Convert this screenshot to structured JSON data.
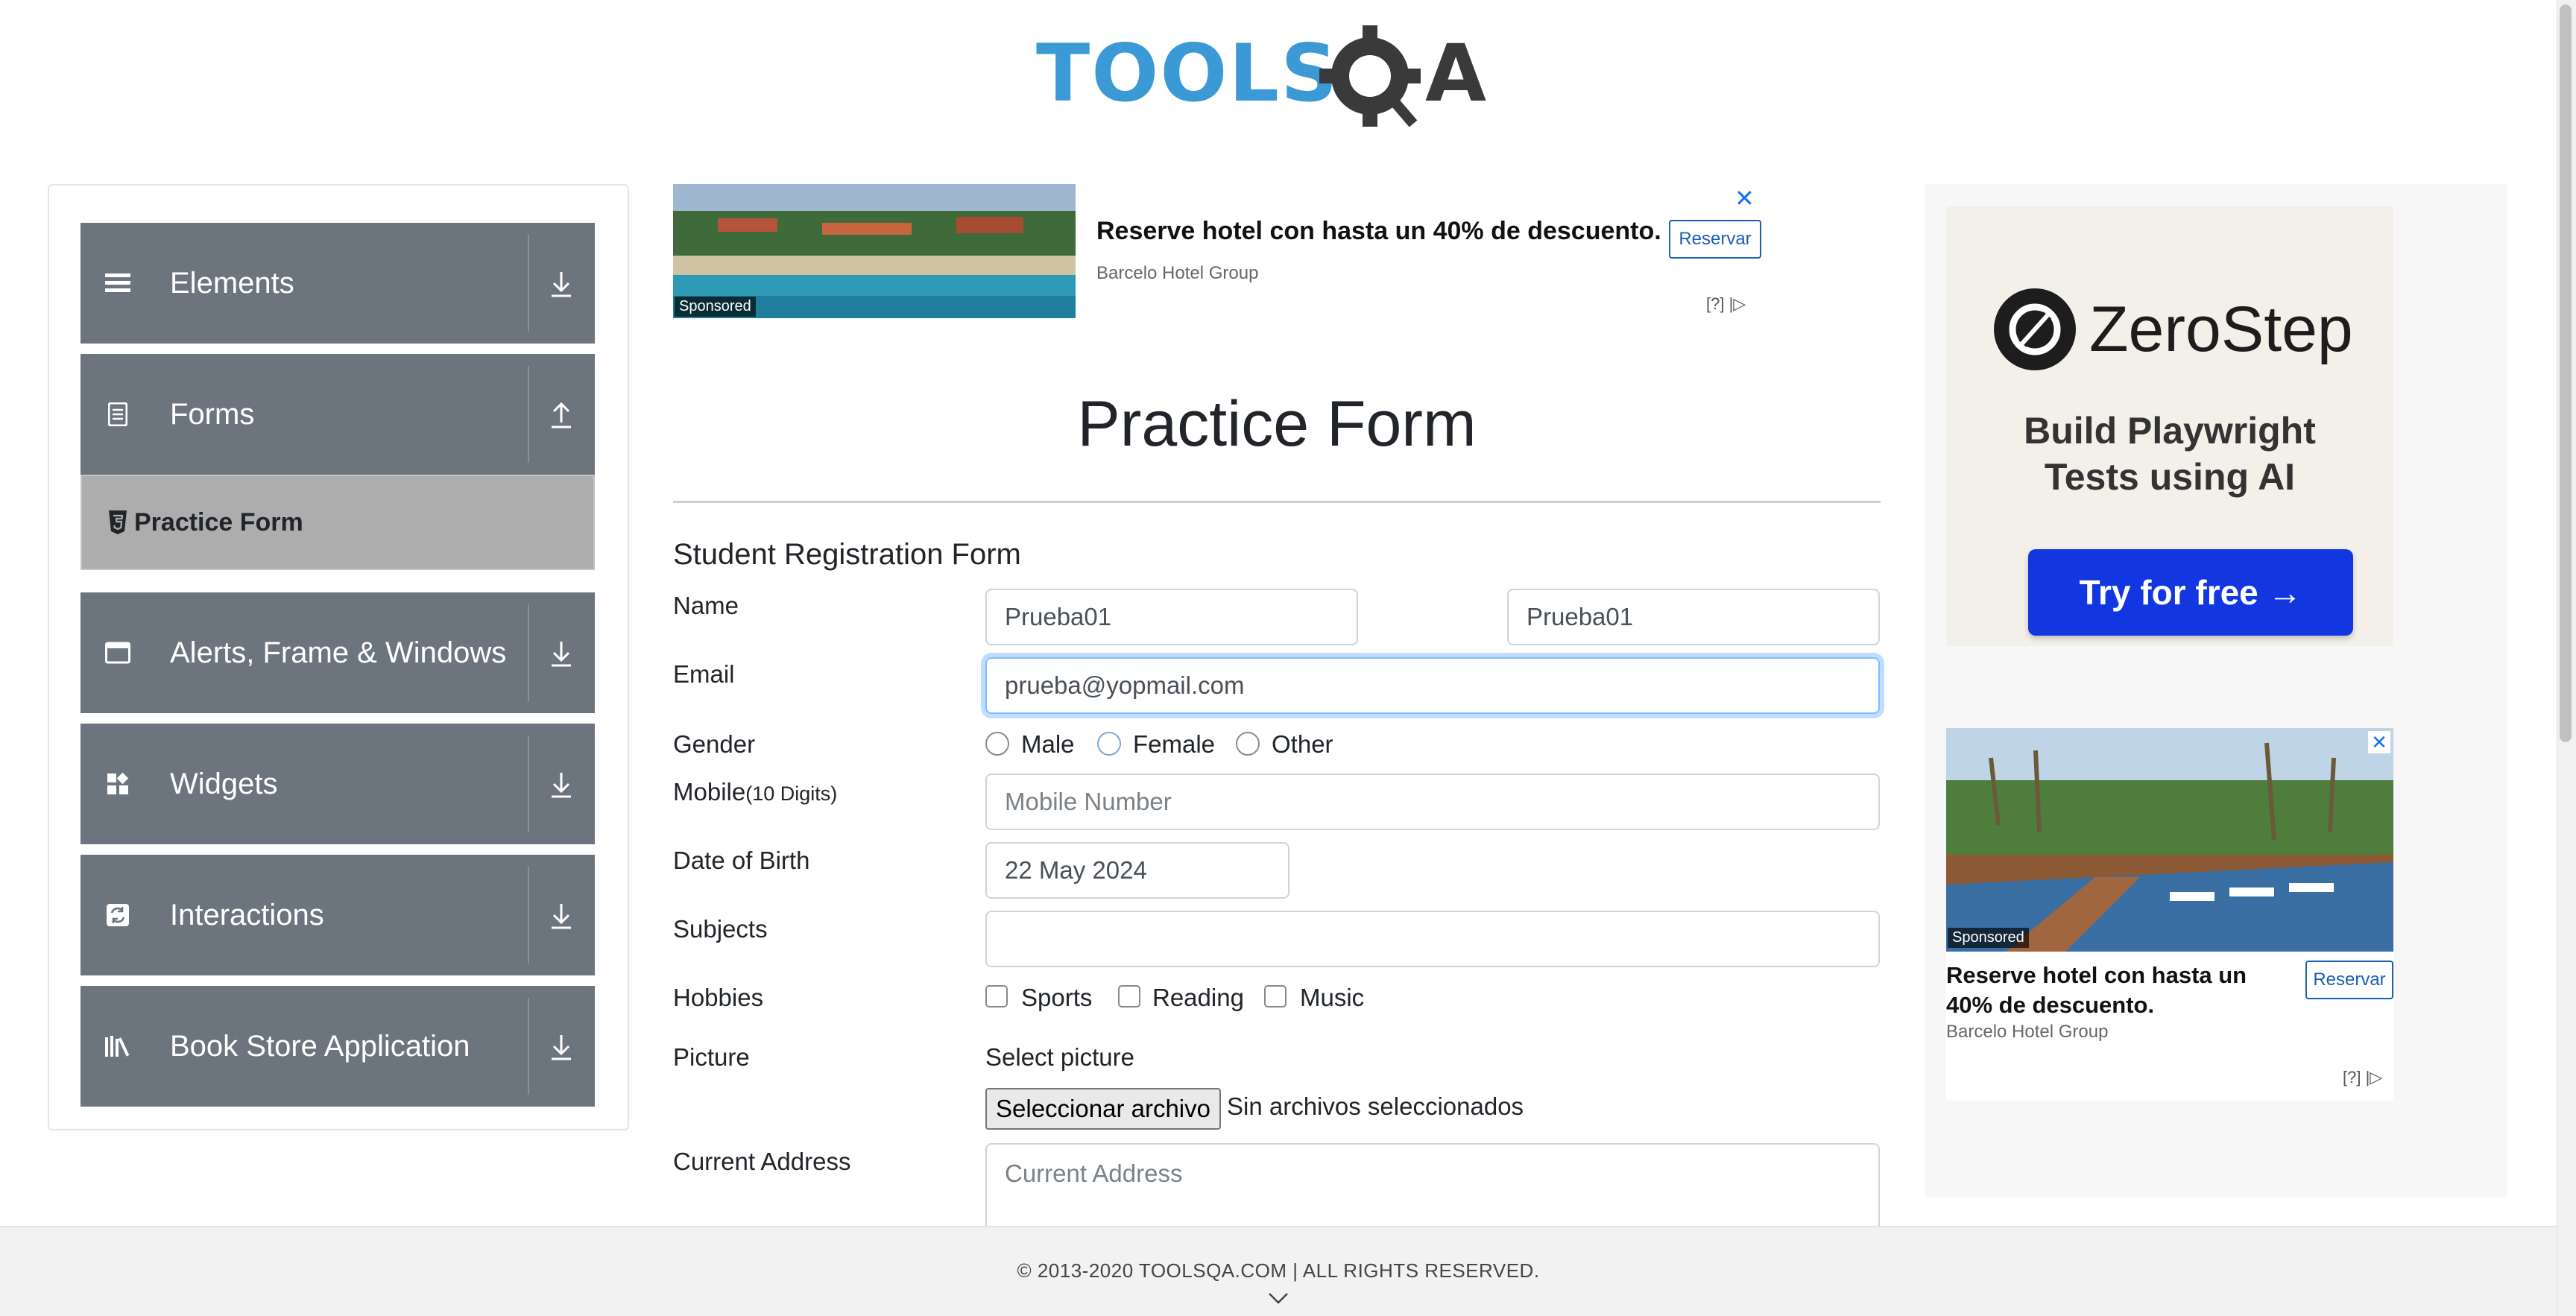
{
  "logo": {
    "part1": "TOOLS",
    "part2": "QA"
  },
  "sidebar": {
    "groups": [
      {
        "label": "Elements",
        "icon": "hamburger-icon",
        "arrow": "download-arrow-icon"
      },
      {
        "label": "Forms",
        "icon": "document-icon",
        "arrow": "upload-arrow-icon"
      },
      {
        "label": "Alerts, Frame & Windows",
        "icon": "window-icon",
        "arrow": "download-arrow-icon"
      },
      {
        "label": "Widgets",
        "icon": "widgets-icon",
        "arrow": "download-arrow-icon"
      },
      {
        "label": "Interactions",
        "icon": "interactions-icon",
        "arrow": "download-arrow-icon"
      },
      {
        "label": "Book Store Application",
        "icon": "books-icon",
        "arrow": "download-arrow-icon"
      }
    ],
    "active_item": {
      "label": "Practice Form",
      "icon": "html5-icon"
    }
  },
  "ad_top": {
    "sponsored": "Sponsored",
    "headline": "Reserve hotel con hasta un 40% de descuento.",
    "brand": "Barcelo Hotel Group",
    "cta": "Reservar",
    "close": "✕",
    "info": "[?] |▷"
  },
  "page": {
    "title": "Practice Form",
    "form_title": "Student Registration Form"
  },
  "form": {
    "name_label": "Name",
    "first_name": "Prueba01",
    "last_name": "Prueba01",
    "email_label": "Email",
    "email_value": "prueba@yopmail.com",
    "gender_label": "Gender",
    "gender_options": [
      "Male",
      "Female",
      "Other"
    ],
    "mobile_label": "Mobile",
    "mobile_hint": "(10 Digits)",
    "mobile_placeholder": "Mobile Number",
    "dob_label": "Date of Birth",
    "dob_value": "22 May 2024",
    "subjects_label": "Subjects",
    "subjects_value": "",
    "hobbies_label": "Hobbies",
    "hobbies_options": [
      "Sports",
      "Reading",
      "Music"
    ],
    "picture_label": "Picture",
    "select_picture": "Select picture",
    "file_button": "Seleccionar archivo",
    "file_status": "Sin archivos seleccionados",
    "address_label": "Current Address",
    "address_placeholder": "Current Address"
  },
  "ad_right": {
    "brand_name": "ZeroStep",
    "tagline_line1": "Build Playwright",
    "tagline_line2": "Tests using AI",
    "cta": "Try for free →",
    "sponsored": "Sponsored",
    "headline": "Reserve hotel con hasta un 40% de descuento.",
    "brand": "Barcelo Hotel Group",
    "button": "Reservar",
    "close": "✕",
    "info": "[?] |▷"
  },
  "footer": {
    "text": "© 2013-2020 TOOLSQA.COM | ALL RIGHTS RESERVED."
  },
  "colors": {
    "sidebar_group": "#6c757d",
    "active_item": "#adadad",
    "logo_blue": "#3b99d6",
    "zerostep_cta": "#1237e0"
  }
}
